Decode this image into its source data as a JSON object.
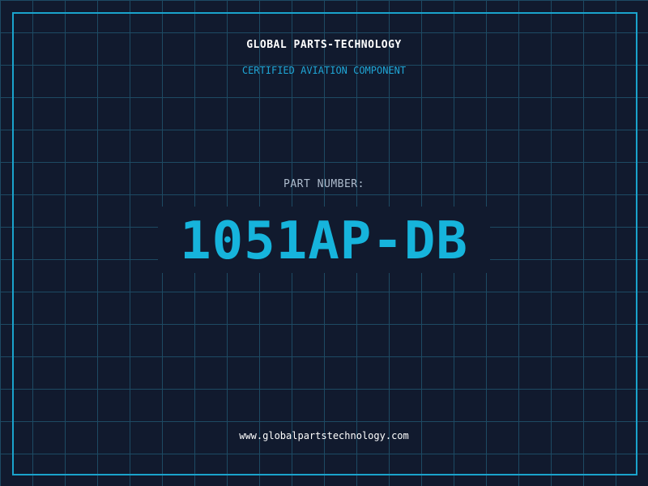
{
  "header": {
    "company": "GLOBAL PARTS-TECHNOLOGY",
    "subtitle": "CERTIFIED AVIATION COMPONENT"
  },
  "part": {
    "label": "PART NUMBER:",
    "number": "1051AP-DB"
  },
  "footer": {
    "website": "www.globalpartstechnology.com"
  },
  "colors": {
    "background": "#111a2e",
    "grid": "#1d4a63",
    "accent": "#16b4dc",
    "label": "#aebccd",
    "text": "#ffffff"
  }
}
